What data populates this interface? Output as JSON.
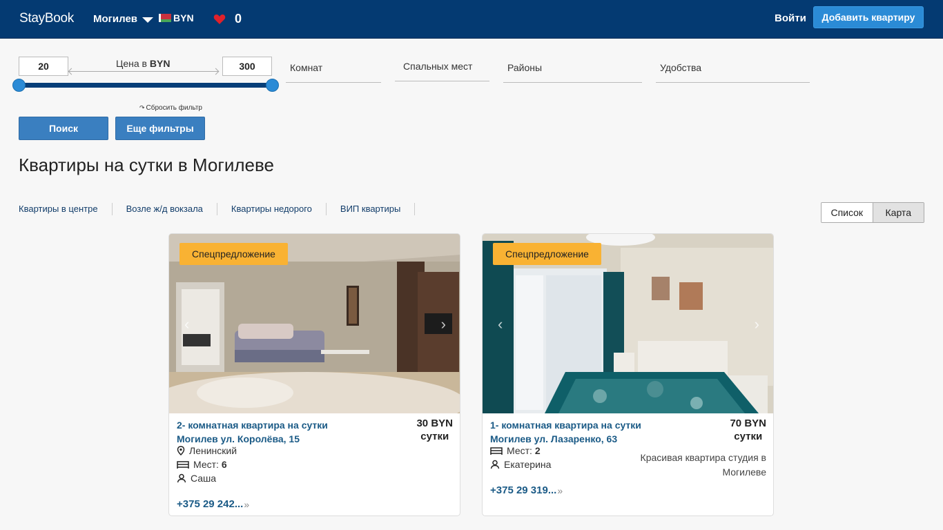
{
  "header": {
    "brand": "StayBook",
    "city": "Могилев",
    "currency": "BYN",
    "favorites_count": "0",
    "login": "Войти",
    "add_button": "Добавить квартиру"
  },
  "filters": {
    "price_min": "20",
    "price_max": "300",
    "price_label_prefix": "Цена в",
    "price_label_currency": "BYN",
    "rooms": "Комнат",
    "sleeping": "Спальных мест",
    "districts": "Районы",
    "amenities": "Удобства",
    "reset": "Сбросить фильтр",
    "search": "Поиск",
    "more_filters": "Еще фильтры"
  },
  "page_title": "Квартиры на сутки в Могилеве",
  "quick_links": [
    "Квартиры в центре",
    "Возле ж/д вокзала",
    "Квартиры недорого",
    "ВИП квартиры"
  ],
  "view_toggle": {
    "list": "Список",
    "map": "Карта"
  },
  "colors": {
    "header": "#043a72",
    "accent": "#2b8bd6",
    "badge": "#f9b233",
    "link": "#1a5a86"
  },
  "listings": [
    {
      "badge": "Спецпредложение",
      "title": "2- комнатная квартира на сутки",
      "address": "Могилев ул. Королёва, 15",
      "price": "30 BYN",
      "price_unit": "сутки",
      "district": "Ленинский",
      "places_label": "Мест:",
      "places": "6",
      "host": "Саша",
      "phone": "+375 29 242..."
    },
    {
      "badge": "Спецпредложение",
      "title": "1- комнатная квартира на сутки",
      "address": "Могилев ул. Лазаренко, 63",
      "price": "70 BYN",
      "price_unit": "сутки",
      "places_label": "Мест:",
      "places": "2",
      "host": "Екатерина",
      "description": "Красивая квартира студия в Могилеве",
      "phone": "+375 29 319..."
    }
  ]
}
